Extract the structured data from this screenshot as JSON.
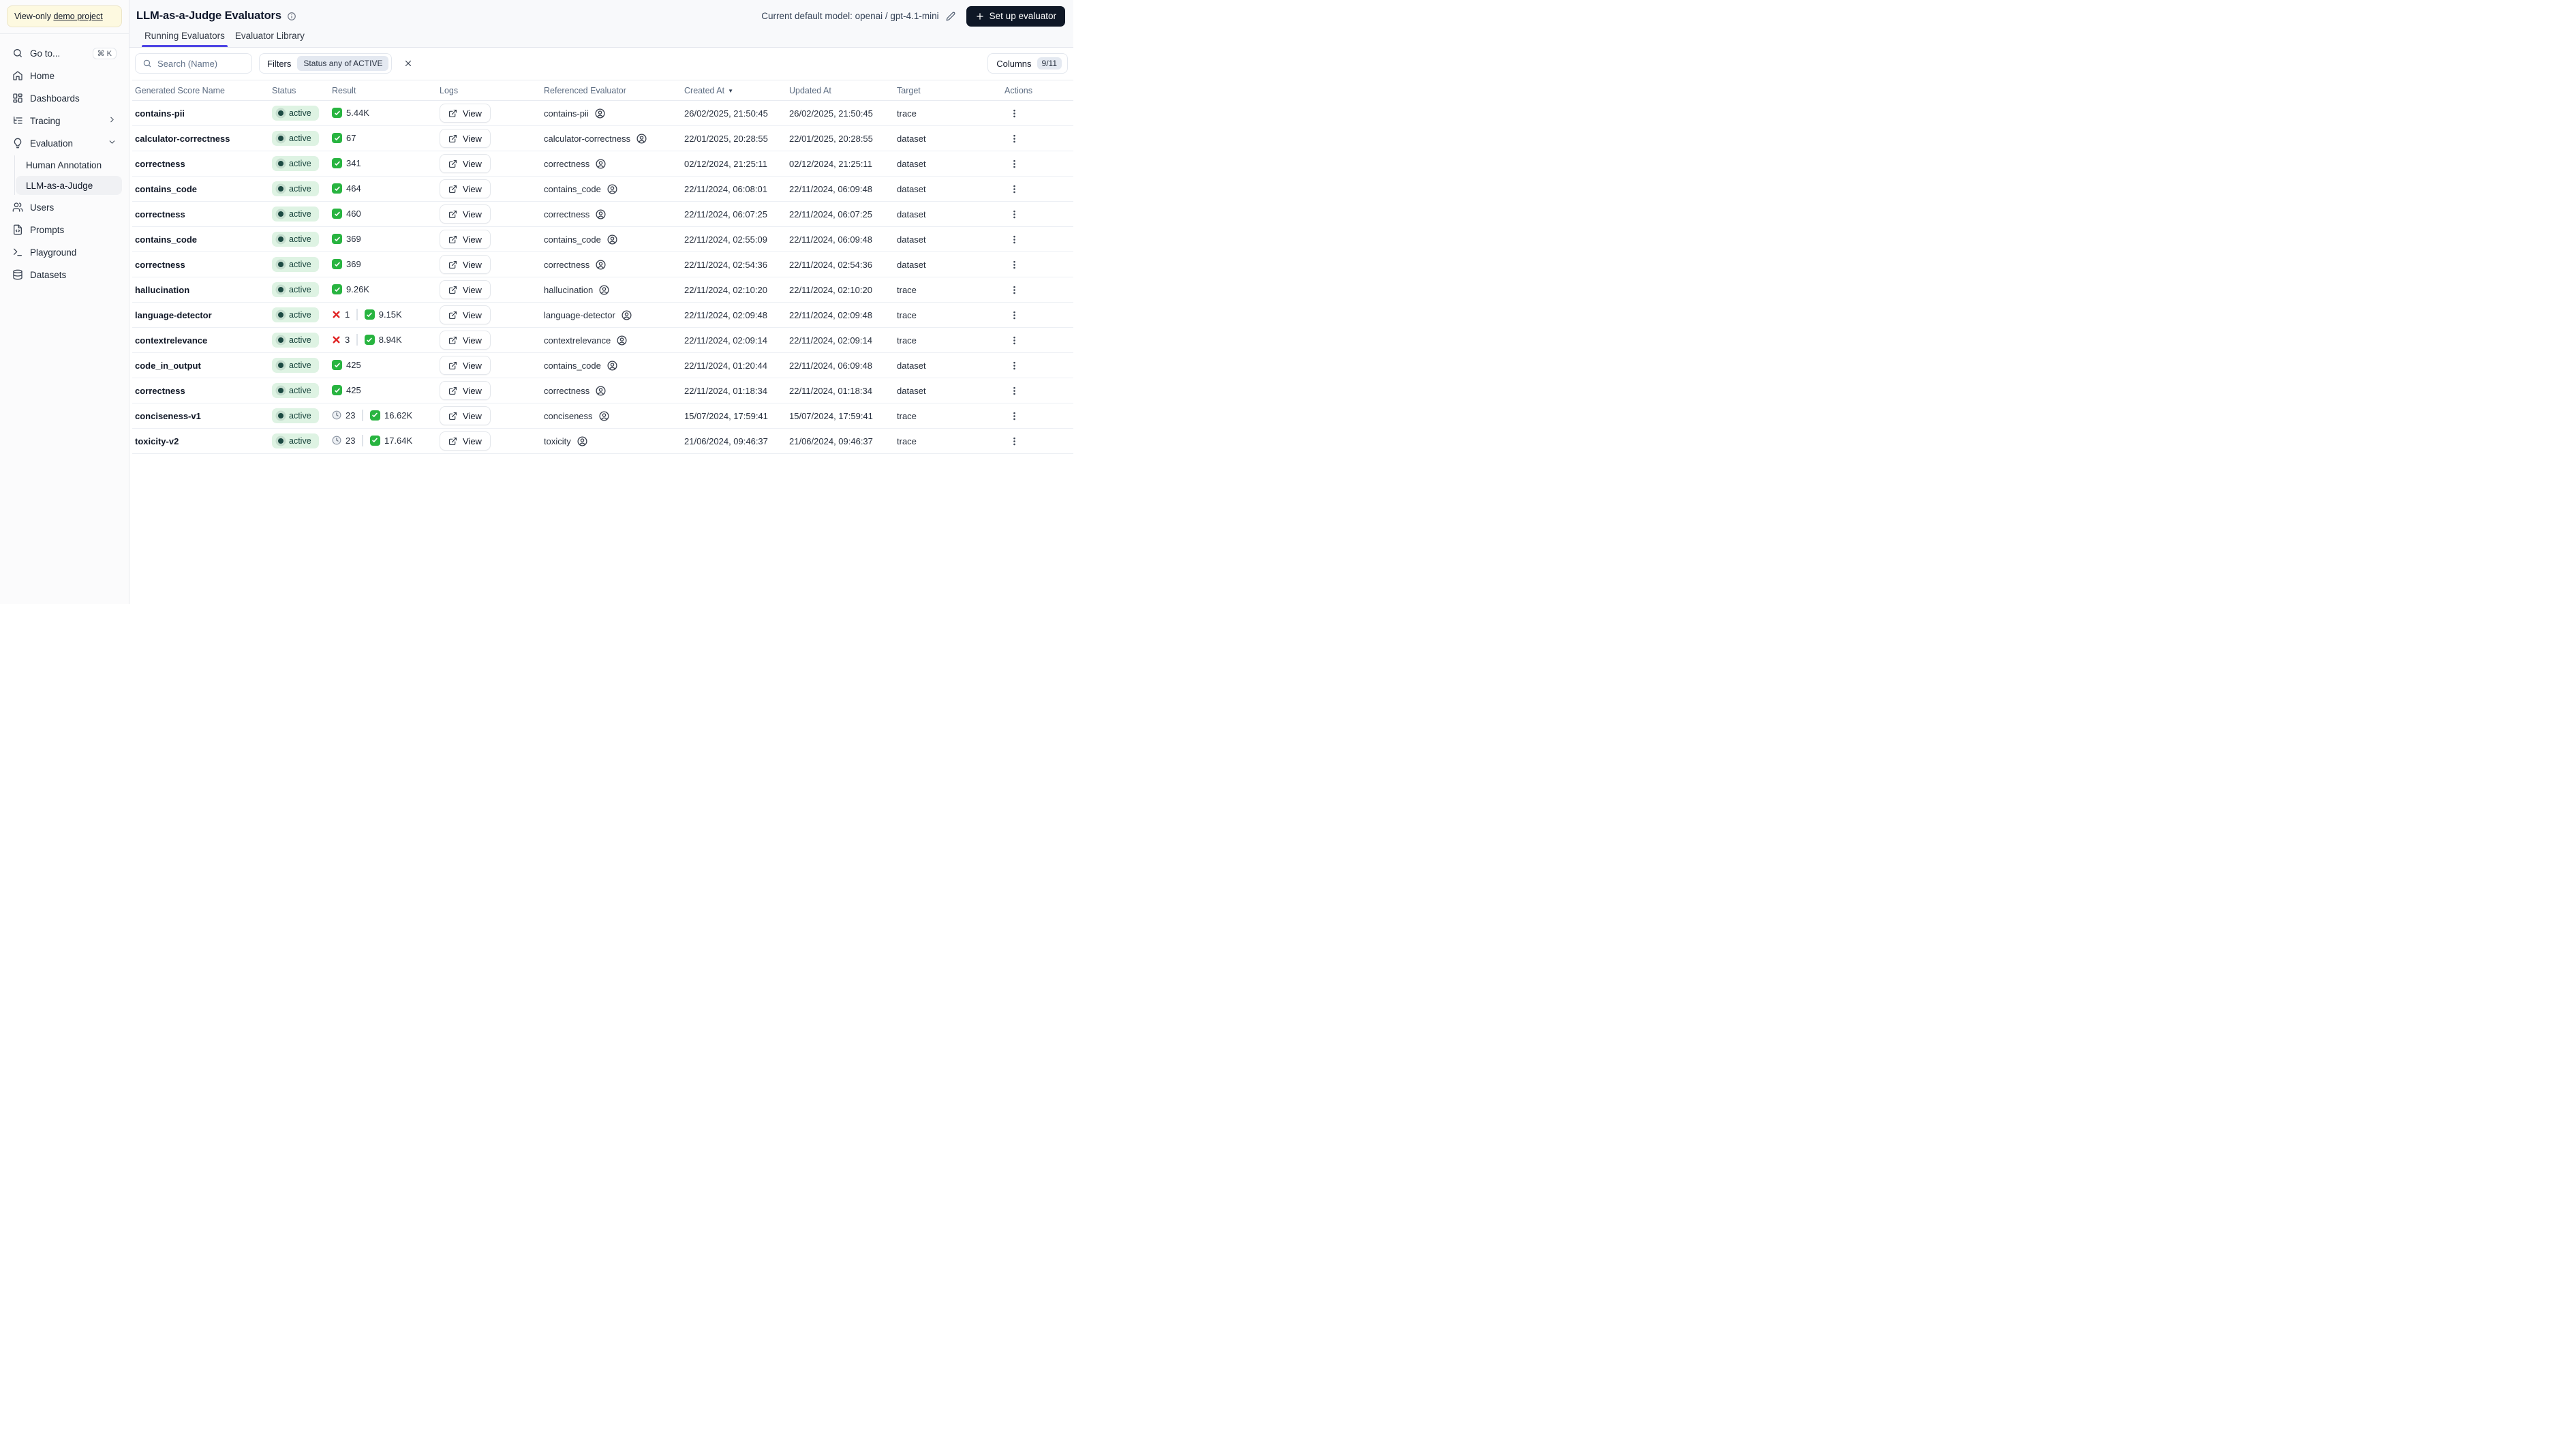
{
  "colors": {
    "accent_indigo": "#4f46e5",
    "primary_button_bg": "#0e1726",
    "status_active_bg": "#def3e3",
    "status_active_text": "#17433c",
    "success_green": "#28b440",
    "error_red": "#e02424",
    "banner_yellow_bg": "#fdf9e0"
  },
  "sidebar": {
    "banner_prefix": "View-only",
    "banner_link": "demo project",
    "goto_label": "Go to...",
    "goto_shortcut": "⌘ K",
    "nav": [
      {
        "label": "Home"
      },
      {
        "label": "Dashboards"
      },
      {
        "label": "Tracing"
      },
      {
        "label": "Evaluation"
      },
      {
        "label": "Human Annotation"
      },
      {
        "label": "LLM-as-a-Judge"
      },
      {
        "label": "Users"
      },
      {
        "label": "Prompts"
      },
      {
        "label": "Playground"
      },
      {
        "label": "Datasets"
      }
    ]
  },
  "header": {
    "title": "LLM-as-a-Judge Evaluators",
    "model_label": "Current default model: openai / gpt-4.1-mini",
    "setup_label": "Set up evaluator",
    "tabs": [
      {
        "label": "Running Evaluators",
        "active": true
      },
      {
        "label": "Evaluator Library",
        "active": false
      }
    ]
  },
  "toolbar": {
    "search_placeholder": "Search (Name)",
    "filters_label": "Filters",
    "filter_chip": "Status any of ACTIVE",
    "columns_label": "Columns",
    "columns_badge": "9/11"
  },
  "table": {
    "columns": [
      "Generated Score Name",
      "Status",
      "Result",
      "Logs",
      "Referenced Evaluator",
      "Created At",
      "Updated At",
      "Target",
      "Actions"
    ],
    "sorted_column": "Created At",
    "sort_direction": "desc",
    "logs_button_label": "View",
    "rows": [
      {
        "name": "contains-pii",
        "status": "active",
        "result": {
          "pending": null,
          "error": null,
          "success": "5.44K"
        },
        "evaluator": "contains-pii",
        "created": "26/02/2025, 21:50:45",
        "updated": "26/02/2025, 21:50:45",
        "target": "trace"
      },
      {
        "name": "calculator-correctness",
        "status": "active",
        "result": {
          "pending": null,
          "error": null,
          "success": "67"
        },
        "evaluator": "calculator-correctness",
        "created": "22/01/2025, 20:28:55",
        "updated": "22/01/2025, 20:28:55",
        "target": "dataset"
      },
      {
        "name": "correctness",
        "status": "active",
        "result": {
          "pending": null,
          "error": null,
          "success": "341"
        },
        "evaluator": "correctness",
        "created": "02/12/2024, 21:25:11",
        "updated": "02/12/2024, 21:25:11",
        "target": "dataset"
      },
      {
        "name": "contains_code",
        "status": "active",
        "result": {
          "pending": null,
          "error": null,
          "success": "464"
        },
        "evaluator": "contains_code",
        "created": "22/11/2024, 06:08:01",
        "updated": "22/11/2024, 06:09:48",
        "target": "dataset"
      },
      {
        "name": "correctness",
        "status": "active",
        "result": {
          "pending": null,
          "error": null,
          "success": "460"
        },
        "evaluator": "correctness",
        "created": "22/11/2024, 06:07:25",
        "updated": "22/11/2024, 06:07:25",
        "target": "dataset"
      },
      {
        "name": "contains_code",
        "status": "active",
        "result": {
          "pending": null,
          "error": null,
          "success": "369"
        },
        "evaluator": "contains_code",
        "created": "22/11/2024, 02:55:09",
        "updated": "22/11/2024, 06:09:48",
        "target": "dataset"
      },
      {
        "name": "correctness",
        "status": "active",
        "result": {
          "pending": null,
          "error": null,
          "success": "369"
        },
        "evaluator": "correctness",
        "created": "22/11/2024, 02:54:36",
        "updated": "22/11/2024, 02:54:36",
        "target": "dataset"
      },
      {
        "name": "hallucination",
        "status": "active",
        "result": {
          "pending": null,
          "error": null,
          "success": "9.26K"
        },
        "evaluator": "hallucination",
        "created": "22/11/2024, 02:10:20",
        "updated": "22/11/2024, 02:10:20",
        "target": "trace"
      },
      {
        "name": "language-detector",
        "status": "active",
        "result": {
          "pending": null,
          "error": "1",
          "success": "9.15K"
        },
        "evaluator": "language-detector",
        "created": "22/11/2024, 02:09:48",
        "updated": "22/11/2024, 02:09:48",
        "target": "trace"
      },
      {
        "name": "contextrelevance",
        "status": "active",
        "result": {
          "pending": null,
          "error": "3",
          "success": "8.94K"
        },
        "evaluator": "contextrelevance",
        "created": "22/11/2024, 02:09:14",
        "updated": "22/11/2024, 02:09:14",
        "target": "trace"
      },
      {
        "name": "code_in_output",
        "status": "active",
        "result": {
          "pending": null,
          "error": null,
          "success": "425"
        },
        "evaluator": "contains_code",
        "created": "22/11/2024, 01:20:44",
        "updated": "22/11/2024, 06:09:48",
        "target": "dataset"
      },
      {
        "name": "correctness",
        "status": "active",
        "result": {
          "pending": null,
          "error": null,
          "success": "425"
        },
        "evaluator": "correctness",
        "created": "22/11/2024, 01:18:34",
        "updated": "22/11/2024, 01:18:34",
        "target": "dataset"
      },
      {
        "name": "conciseness-v1",
        "status": "active",
        "result": {
          "pending": "23",
          "error": null,
          "success": "16.62K"
        },
        "evaluator": "conciseness",
        "created": "15/07/2024, 17:59:41",
        "updated": "15/07/2024, 17:59:41",
        "target": "trace"
      },
      {
        "name": "toxicity-v2",
        "status": "active",
        "result": {
          "pending": "23",
          "error": null,
          "success": "17.64K"
        },
        "evaluator": "toxicity",
        "created": "21/06/2024, 09:46:37",
        "updated": "21/06/2024, 09:46:37",
        "target": "trace"
      }
    ]
  }
}
